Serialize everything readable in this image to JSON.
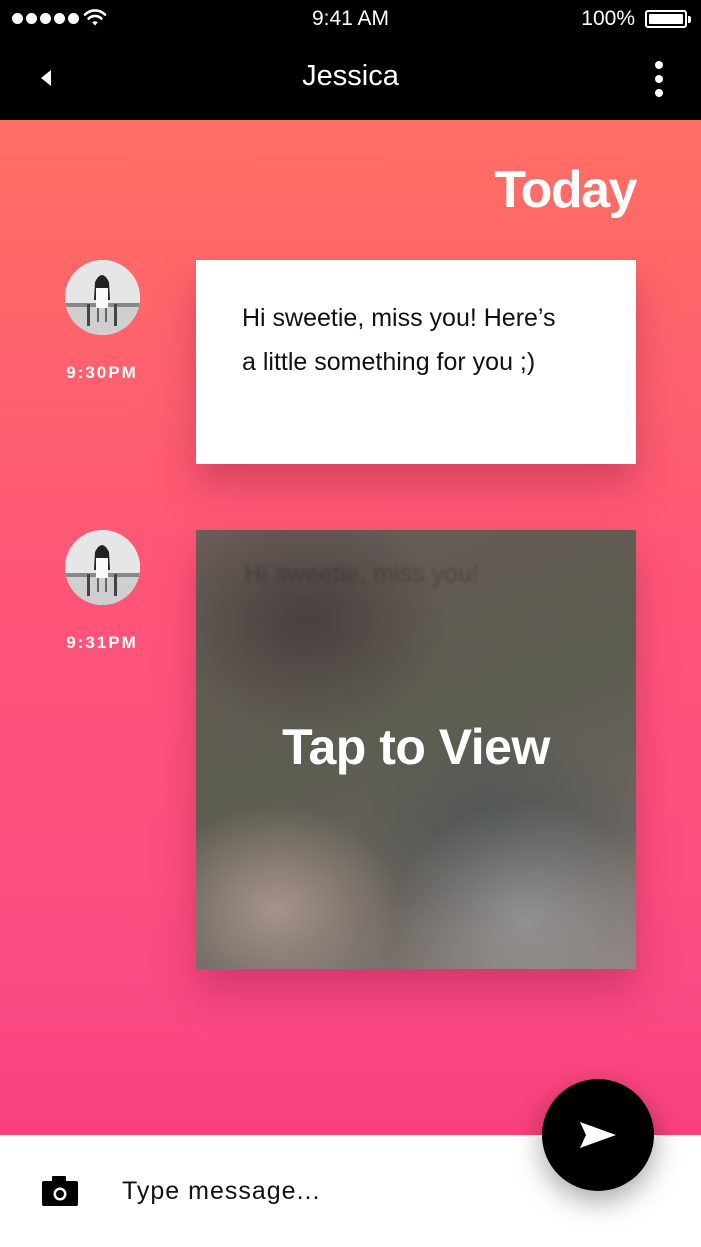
{
  "status_bar": {
    "time": "9:41 AM",
    "battery_percent": "100%"
  },
  "header": {
    "contact_name": "Jessica",
    "back_icon": "back-arrow-icon",
    "menu_icon": "more-vertical-icon"
  },
  "conversation": {
    "date_header": "Today",
    "messages": [
      {
        "time": "9:30PM",
        "text_line1": "Hi sweetie, miss you! Here’s",
        "text_line2": "a little something for you ;)"
      },
      {
        "time": "9:31PM",
        "ghost_text": "Hi sweetie, miss you!",
        "action_label": "Tap to View"
      }
    ]
  },
  "composer": {
    "placeholder": "Type message...",
    "camera_icon": "camera-icon",
    "send_icon": "send-icon"
  },
  "colors": {
    "gradient_top": "#ff6f63",
    "gradient_bottom": "#f8407d",
    "bar_background": "#000000"
  }
}
